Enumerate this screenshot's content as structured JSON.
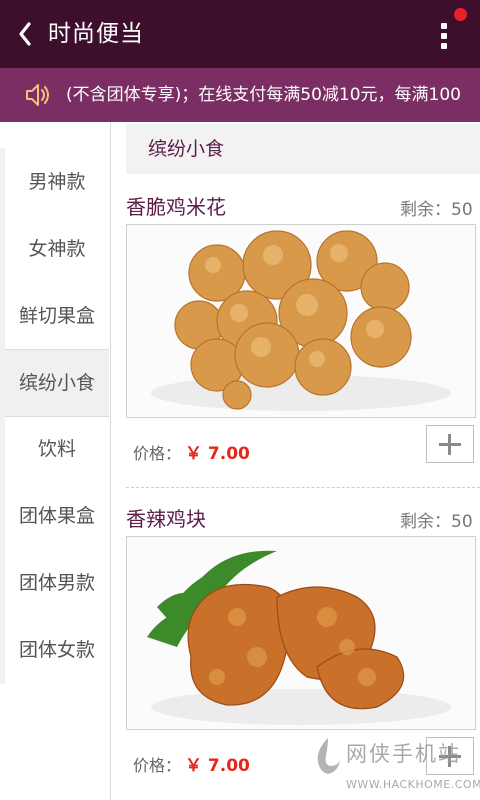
{
  "header": {
    "title": "时尚便当",
    "back_icon": "chevron-left-icon",
    "menu_icon": "vertical-dots-icon",
    "notification_color": "#e8202a",
    "bg_color": "#3e0f2c"
  },
  "notice": {
    "icon": "speaker-icon",
    "text": "(不含团体专享)；在线支付每满50减10元，每满100",
    "bg_color": "#7b2e63"
  },
  "sidebar": {
    "items": [
      {
        "label": "男神款",
        "active": false
      },
      {
        "label": "女神款",
        "active": false
      },
      {
        "label": "鲜切果盒",
        "active": false
      },
      {
        "label": "缤纷小食",
        "active": true
      },
      {
        "label": "饮料",
        "active": false
      },
      {
        "label": "团体果盒",
        "active": false
      },
      {
        "label": "团体男款",
        "active": false
      },
      {
        "label": "团体女款",
        "active": false
      }
    ]
  },
  "category": {
    "title": "缤纷小食"
  },
  "products": [
    {
      "name": "香脆鸡米花",
      "stock": "剩余：50",
      "price_label": "价格：",
      "price": "￥ 7.00",
      "image": "popcorn-chicken-image"
    },
    {
      "name": "香辣鸡块",
      "stock": "剩余：50",
      "price_label": "价格：",
      "price": "￥ 7.00",
      "image": "spicy-chicken-nuggets-image"
    }
  ],
  "watermark": {
    "text": "网侠手机站",
    "url": "WWW.HACKHOME.COM"
  },
  "colors": {
    "accent": "#5a1e48",
    "price": "#e3271a"
  }
}
